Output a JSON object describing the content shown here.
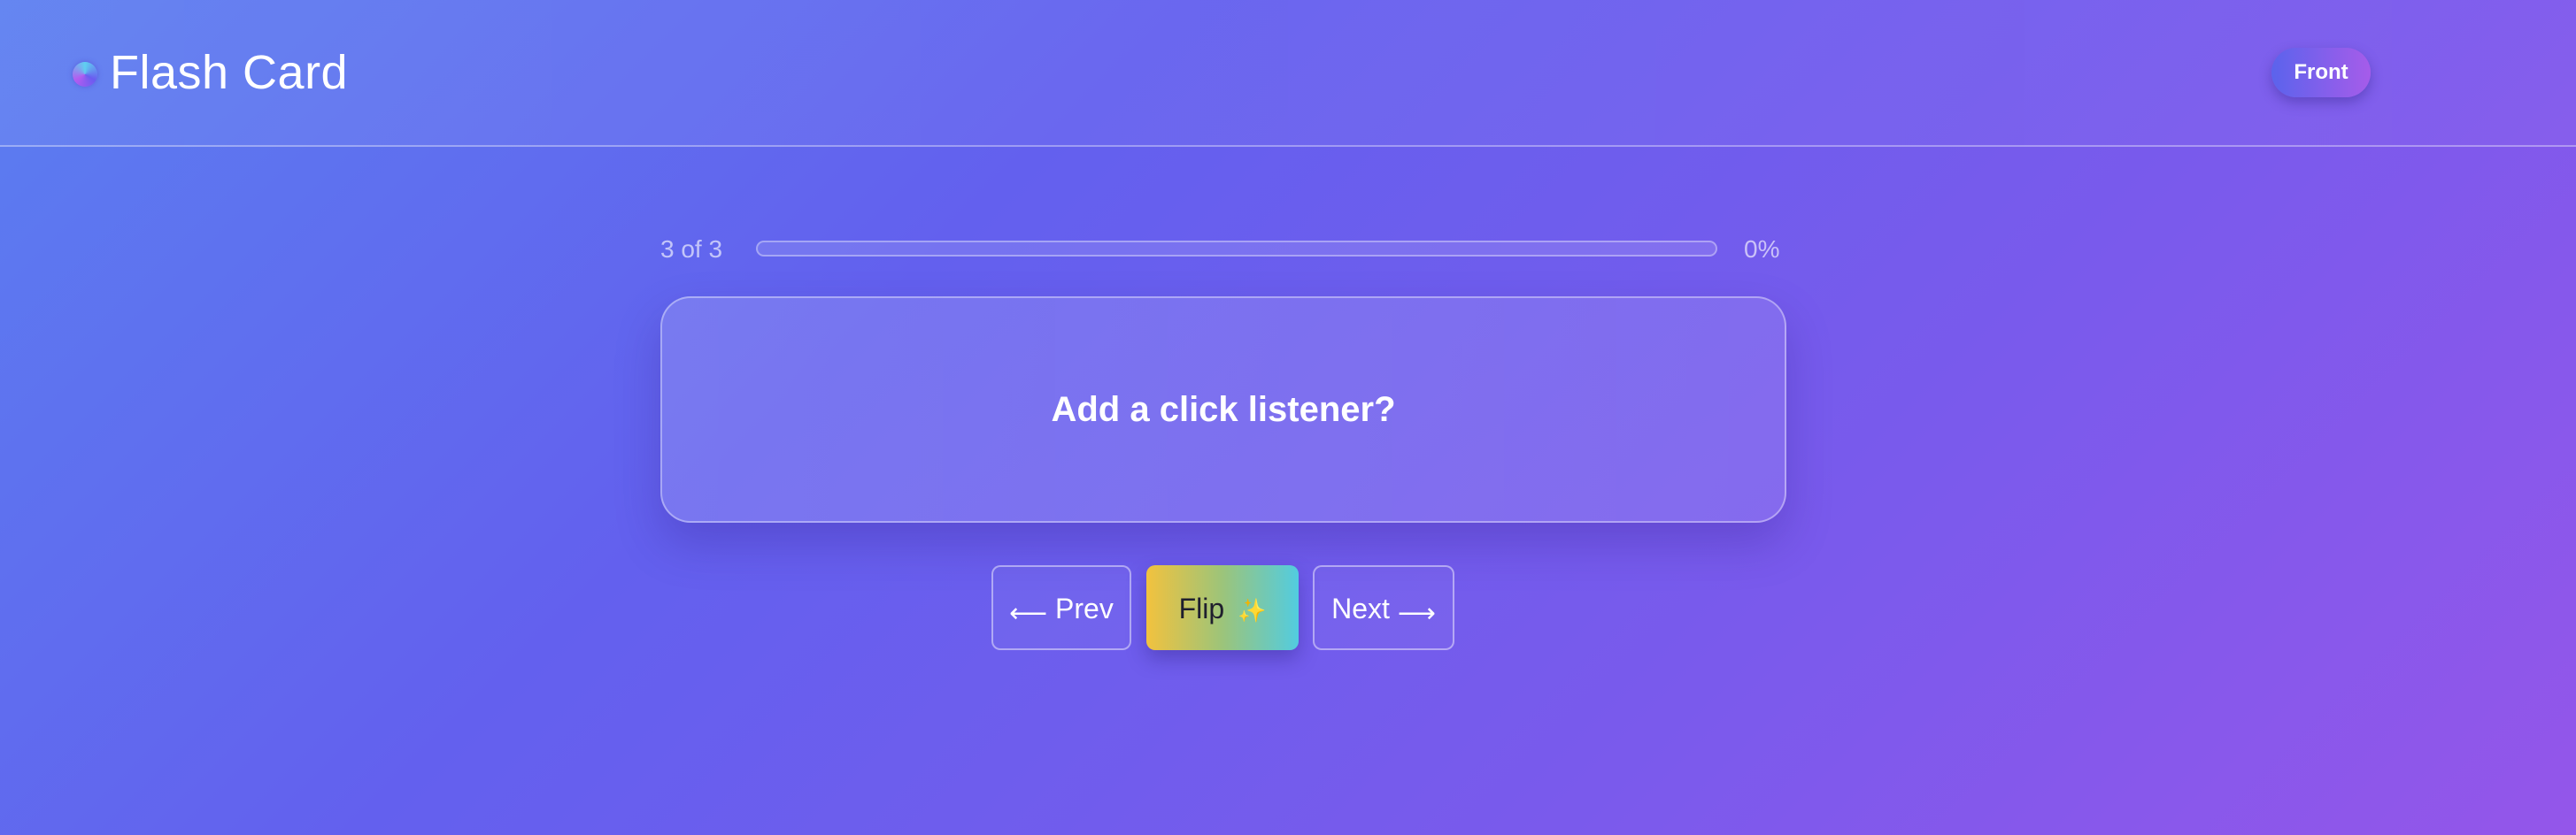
{
  "header": {
    "title": "Flash Card",
    "side_label": "Front"
  },
  "progress": {
    "count_text": "3 of 3",
    "percent_text": "0%",
    "fraction": 0
  },
  "card": {
    "text": "Add a click listener?"
  },
  "controls": {
    "prev_arrow": "⟵",
    "prev_label": "Prev",
    "flip_label": "Flip",
    "flip_sparkle": "✨",
    "next_label": "Next",
    "next_arrow": "⟶"
  },
  "icons": {
    "logo": "gradient-orb-icon",
    "sparkle": "sparkles-icon"
  },
  "colors": {
    "background_start": "#5b7ef0",
    "background_end": "#9456ea",
    "flip_gradient_start": "#f2c23e",
    "flip_gradient_end": "#52cce0",
    "badge_gradient_start": "#5b63ec",
    "badge_gradient_end": "#a65cea"
  }
}
